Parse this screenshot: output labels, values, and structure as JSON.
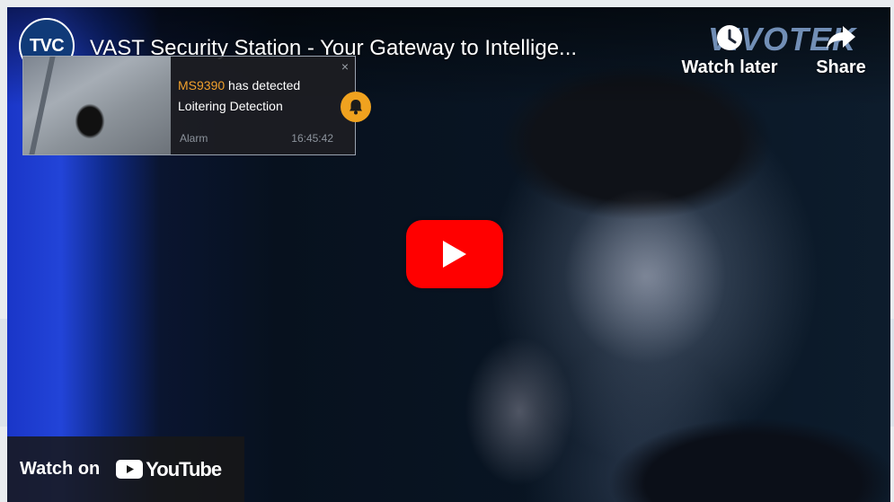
{
  "video": {
    "channel_avatar_text": "TVC",
    "title": "VAST Security Station - Your Gateway to Intellige...",
    "brand_watermark": "VIVOTEK",
    "watch_later_label": "Watch later",
    "share_label": "Share",
    "watch_on_label": "Watch on",
    "youtube_logo_text": "YouTube"
  },
  "notification": {
    "device": "MS9390",
    "detected_text": " has detected",
    "event": "Loitering Detection",
    "type": "Alarm",
    "time": "16:45:42",
    "close_symbol": "×"
  },
  "colors": {
    "play_button": "#FF0000",
    "notification_bell": "#F0A21F",
    "device_highlight": "#F0A02C"
  },
  "icons": [
    "clock-icon",
    "share-arrow-icon",
    "bell-icon",
    "play-icon",
    "youtube-logo-icon",
    "close-icon"
  ]
}
